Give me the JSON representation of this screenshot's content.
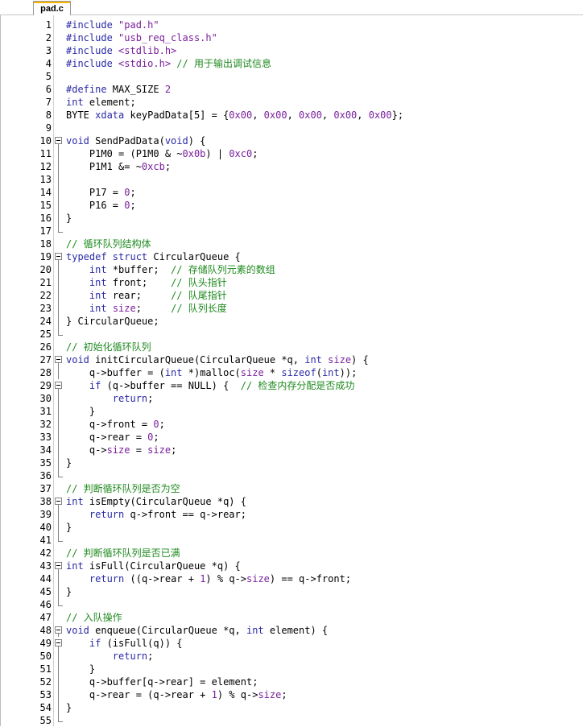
{
  "tab": {
    "label": "pad.c"
  },
  "colors": {
    "keyword": "#2a2aa8",
    "number": "#7a1f9c",
    "comment": "#1f8a1f",
    "text": "#000000",
    "tab_accent": "#f7b500"
  },
  "lines": [
    {
      "n": "1",
      "fold": "",
      "tokens": [
        [
          "mac",
          "#include "
        ],
        [
          "str",
          "\"pad.h\""
        ]
      ]
    },
    {
      "n": "2",
      "fold": "",
      "tokens": [
        [
          "mac",
          "#include "
        ],
        [
          "str",
          "\"usb_req_class.h\""
        ]
      ]
    },
    {
      "n": "3",
      "fold": "",
      "tokens": [
        [
          "mac",
          "#include "
        ],
        [
          "str",
          "<stdlib.h>"
        ]
      ]
    },
    {
      "n": "4",
      "fold": "",
      "tokens": [
        [
          "mac",
          "#include "
        ],
        [
          "str",
          "<stdio.h>"
        ],
        [
          "op",
          " "
        ],
        [
          "cm",
          "// 用于输出调试信息"
        ]
      ]
    },
    {
      "n": "5",
      "fold": "",
      "tokens": []
    },
    {
      "n": "6",
      "fold": "",
      "tokens": [
        [
          "mac",
          "#define "
        ],
        [
          "op",
          "MAX_SIZE "
        ],
        [
          "num",
          "2"
        ]
      ]
    },
    {
      "n": "7",
      "fold": "",
      "tokens": [
        [
          "kw",
          "int"
        ],
        [
          "op",
          " element;"
        ]
      ]
    },
    {
      "n": "8",
      "fold": "",
      "tokens": [
        [
          "op",
          "BYTE "
        ],
        [
          "kw",
          "xdata"
        ],
        [
          "op",
          " keyPadData[5] = {"
        ],
        [
          "num",
          "0x00"
        ],
        [
          "op",
          ", "
        ],
        [
          "num",
          "0x00"
        ],
        [
          "op",
          ", "
        ],
        [
          "num",
          "0x00"
        ],
        [
          "op",
          ", "
        ],
        [
          "num",
          "0x00"
        ],
        [
          "op",
          ", "
        ],
        [
          "num",
          "0x00"
        ],
        [
          "op",
          "};"
        ]
      ]
    },
    {
      "n": "9",
      "fold": "",
      "tokens": []
    },
    {
      "n": "10",
      "fold": "start",
      "tokens": [
        [
          "kw",
          "void"
        ],
        [
          "op",
          " SendPadData("
        ],
        [
          "kw",
          "void"
        ],
        [
          "op",
          ") {"
        ]
      ]
    },
    {
      "n": "11",
      "fold": "bar",
      "tokens": [
        [
          "op",
          "    P1M0 = (P1M0 & ~"
        ],
        [
          "num",
          "0x0b"
        ],
        [
          "op",
          ") | "
        ],
        [
          "num",
          "0xc0"
        ],
        [
          "op",
          ";"
        ]
      ]
    },
    {
      "n": "12",
      "fold": "bar",
      "tokens": [
        [
          "op",
          "    P1M1 &= ~"
        ],
        [
          "num",
          "0xcb"
        ],
        [
          "op",
          ";"
        ]
      ]
    },
    {
      "n": "13",
      "fold": "bar",
      "tokens": []
    },
    {
      "n": "14",
      "fold": "bar",
      "tokens": [
        [
          "op",
          "    P17 = "
        ],
        [
          "num",
          "0"
        ],
        [
          "op",
          ";"
        ]
      ]
    },
    {
      "n": "15",
      "fold": "bar",
      "tokens": [
        [
          "op",
          "    P16 = "
        ],
        [
          "num",
          "0"
        ],
        [
          "op",
          ";"
        ]
      ]
    },
    {
      "n": "16",
      "fold": "bar",
      "tokens": [
        [
          "op",
          "}"
        ]
      ]
    },
    {
      "n": "17",
      "fold": "end",
      "tokens": []
    },
    {
      "n": "18",
      "fold": "",
      "tokens": [
        [
          "cm",
          "// 循环队列结构体"
        ]
      ]
    },
    {
      "n": "19",
      "fold": "start",
      "tokens": [
        [
          "kw",
          "typedef struct"
        ],
        [
          "op",
          " CircularQueue {"
        ]
      ]
    },
    {
      "n": "20",
      "fold": "bar",
      "tokens": [
        [
          "op",
          "    "
        ],
        [
          "kw",
          "int"
        ],
        [
          "op",
          " *buffer;  "
        ],
        [
          "cm",
          "// 存储队列元素的数组"
        ]
      ]
    },
    {
      "n": "21",
      "fold": "bar",
      "tokens": [
        [
          "op",
          "    "
        ],
        [
          "kw",
          "int"
        ],
        [
          "op",
          " front;    "
        ],
        [
          "cm",
          "// 队头指针"
        ]
      ]
    },
    {
      "n": "22",
      "fold": "bar",
      "tokens": [
        [
          "op",
          "    "
        ],
        [
          "kw",
          "int"
        ],
        [
          "op",
          " rear;     "
        ],
        [
          "cm",
          "// 队尾指针"
        ]
      ]
    },
    {
      "n": "23",
      "fold": "bar",
      "tokens": [
        [
          "op",
          "    "
        ],
        [
          "kw",
          "int"
        ],
        [
          "op",
          " "
        ],
        [
          "num",
          "size"
        ],
        [
          "op",
          ";     "
        ],
        [
          "cm",
          "// 队列长度"
        ]
      ]
    },
    {
      "n": "24",
      "fold": "bar",
      "tokens": [
        [
          "op",
          "} CircularQueue;"
        ]
      ]
    },
    {
      "n": "25",
      "fold": "end",
      "tokens": []
    },
    {
      "n": "26",
      "fold": "",
      "tokens": [
        [
          "cm",
          "// 初始化循环队列"
        ]
      ]
    },
    {
      "n": "27",
      "fold": "start",
      "tokens": [
        [
          "kw",
          "void"
        ],
        [
          "op",
          " initCircularQueue(CircularQueue *q, "
        ],
        [
          "kw",
          "int"
        ],
        [
          "op",
          " "
        ],
        [
          "num",
          "size"
        ],
        [
          "op",
          ") {"
        ]
      ]
    },
    {
      "n": "28",
      "fold": "bar",
      "tokens": [
        [
          "op",
          "    q->buffer = ("
        ],
        [
          "kw",
          "int"
        ],
        [
          "op",
          " *)malloc("
        ],
        [
          "num",
          "size"
        ],
        [
          "op",
          " * "
        ],
        [
          "kw",
          "sizeof"
        ],
        [
          "op",
          "("
        ],
        [
          "kw",
          "int"
        ],
        [
          "op",
          "));"
        ]
      ]
    },
    {
      "n": "29",
      "fold": "start2",
      "tokens": [
        [
          "op",
          "    "
        ],
        [
          "kw",
          "if"
        ],
        [
          "op",
          " (q->buffer == NULL) {  "
        ],
        [
          "cm",
          "// 检查内存分配是否成功"
        ]
      ]
    },
    {
      "n": "30",
      "fold": "bar",
      "tokens": [
        [
          "op",
          "        "
        ],
        [
          "kw",
          "return"
        ],
        [
          "op",
          ";"
        ]
      ]
    },
    {
      "n": "31",
      "fold": "end2",
      "tokens": [
        [
          "op",
          "    }"
        ]
      ]
    },
    {
      "n": "32",
      "fold": "bar",
      "tokens": [
        [
          "op",
          "    q->front = "
        ],
        [
          "num",
          "0"
        ],
        [
          "op",
          ";"
        ]
      ]
    },
    {
      "n": "33",
      "fold": "bar",
      "tokens": [
        [
          "op",
          "    q->rear = "
        ],
        [
          "num",
          "0"
        ],
        [
          "op",
          ";"
        ]
      ]
    },
    {
      "n": "34",
      "fold": "bar",
      "tokens": [
        [
          "op",
          "    q->"
        ],
        [
          "num",
          "size"
        ],
        [
          "op",
          " = "
        ],
        [
          "num",
          "size"
        ],
        [
          "op",
          ";"
        ]
      ]
    },
    {
      "n": "35",
      "fold": "bar",
      "tokens": [
        [
          "op",
          "}"
        ]
      ]
    },
    {
      "n": "36",
      "fold": "end",
      "tokens": []
    },
    {
      "n": "37",
      "fold": "",
      "tokens": [
        [
          "cm",
          "// 判断循环队列是否为空"
        ]
      ]
    },
    {
      "n": "38",
      "fold": "start",
      "tokens": [
        [
          "kw",
          "int"
        ],
        [
          "op",
          " isEmpty(CircularQueue *q) {"
        ]
      ]
    },
    {
      "n": "39",
      "fold": "bar",
      "tokens": [
        [
          "op",
          "    "
        ],
        [
          "kw",
          "return"
        ],
        [
          "op",
          " q->front == q->rear;"
        ]
      ]
    },
    {
      "n": "40",
      "fold": "bar",
      "tokens": [
        [
          "op",
          "}"
        ]
      ]
    },
    {
      "n": "41",
      "fold": "end",
      "tokens": []
    },
    {
      "n": "42",
      "fold": "",
      "tokens": [
        [
          "cm",
          "// 判断循环队列是否已满"
        ]
      ]
    },
    {
      "n": "43",
      "fold": "start",
      "tokens": [
        [
          "kw",
          "int"
        ],
        [
          "op",
          " isFull(CircularQueue *q) {"
        ]
      ]
    },
    {
      "n": "44",
      "fold": "bar",
      "tokens": [
        [
          "op",
          "    "
        ],
        [
          "kw",
          "return"
        ],
        [
          "op",
          " ((q->rear + "
        ],
        [
          "num",
          "1"
        ],
        [
          "op",
          ") % q->"
        ],
        [
          "num",
          "size"
        ],
        [
          "op",
          ") == q->front;"
        ]
      ]
    },
    {
      "n": "45",
      "fold": "bar",
      "tokens": [
        [
          "op",
          "}"
        ]
      ]
    },
    {
      "n": "46",
      "fold": "end",
      "tokens": []
    },
    {
      "n": "47",
      "fold": "",
      "tokens": [
        [
          "cm",
          "// 入队操作"
        ]
      ]
    },
    {
      "n": "48",
      "fold": "start",
      "tokens": [
        [
          "kw",
          "void"
        ],
        [
          "op",
          " enqueue(CircularQueue *q, "
        ],
        [
          "kw",
          "int"
        ],
        [
          "op",
          " element) {"
        ]
      ]
    },
    {
      "n": "49",
      "fold": "start2",
      "tokens": [
        [
          "op",
          "    "
        ],
        [
          "kw",
          "if"
        ],
        [
          "op",
          " (isFull(q)) {"
        ]
      ]
    },
    {
      "n": "50",
      "fold": "bar",
      "tokens": [
        [
          "op",
          "        "
        ],
        [
          "kw",
          "return"
        ],
        [
          "op",
          ";"
        ]
      ]
    },
    {
      "n": "51",
      "fold": "end2",
      "tokens": [
        [
          "op",
          "    }"
        ]
      ]
    },
    {
      "n": "52",
      "fold": "bar",
      "tokens": [
        [
          "op",
          "    q->buffer[q->rear] = element;"
        ]
      ]
    },
    {
      "n": "53",
      "fold": "bar",
      "tokens": [
        [
          "op",
          "    q->rear = (q->rear + "
        ],
        [
          "num",
          "1"
        ],
        [
          "op",
          ") % q->"
        ],
        [
          "num",
          "size"
        ],
        [
          "op",
          ";"
        ]
      ]
    },
    {
      "n": "54",
      "fold": "bar",
      "tokens": [
        [
          "op",
          "}"
        ]
      ]
    },
    {
      "n": "55",
      "fold": "end",
      "tokens": []
    }
  ]
}
